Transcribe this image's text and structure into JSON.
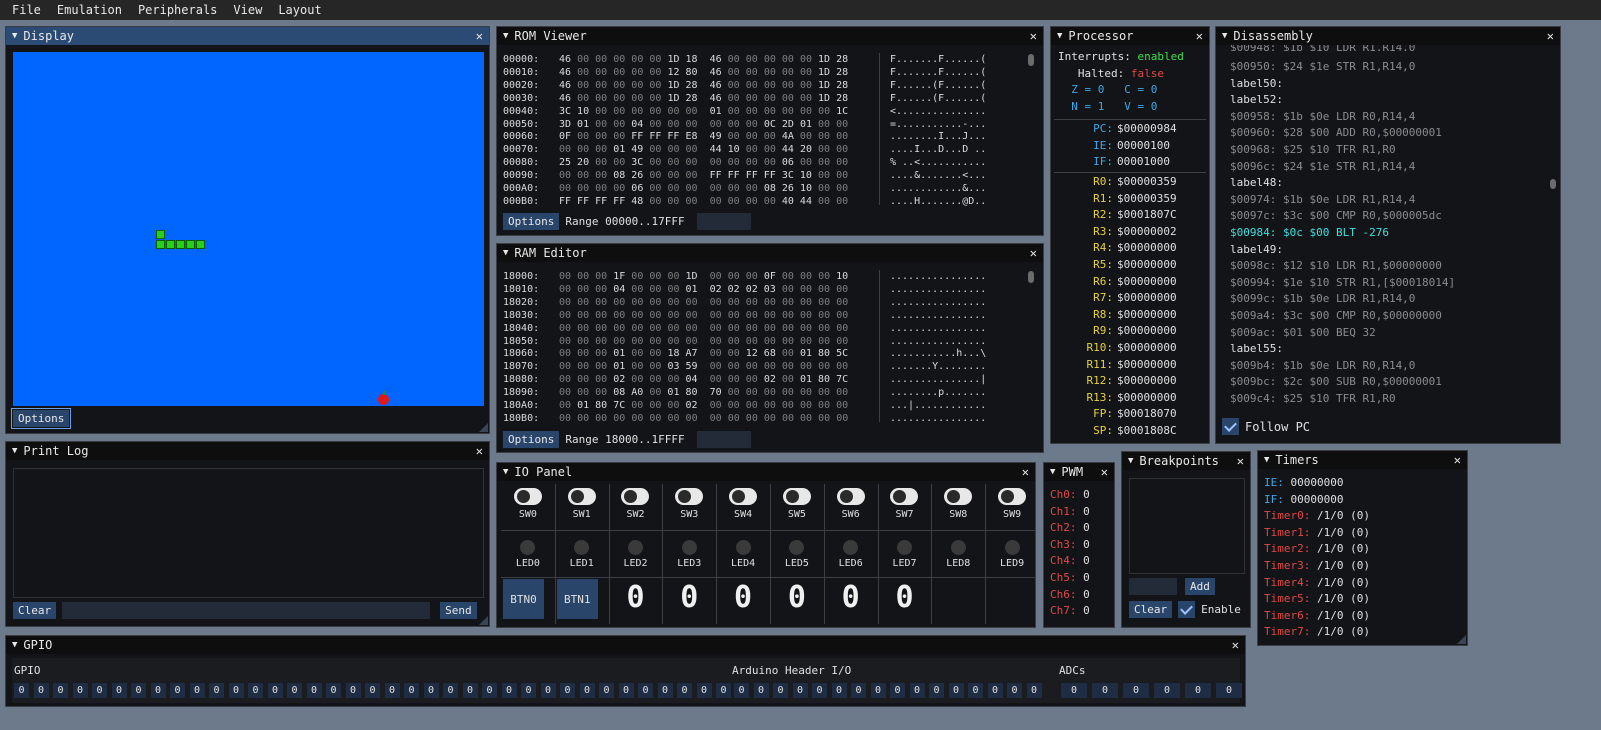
{
  "menu": [
    "File",
    "Emulation",
    "Peripherals",
    "View",
    "Layout"
  ],
  "display": {
    "title": "Display",
    "options": "Options"
  },
  "rom": {
    "title": "ROM Viewer",
    "rows": [
      [
        "00000:",
        "46 00 00 00 00 00 1D 18  46 00 00 00 00 00 1D 28",
        "F.......F......("
      ],
      [
        "00010:",
        "46 00 00 00 00 00 12 80  46 00 00 00 00 00 1D 28",
        "F.......F......("
      ],
      [
        "00020:",
        "46 00 00 00 00 00 1D 28  46 00 00 00 00 00 1D 28",
        "F......(F......("
      ],
      [
        "00030:",
        "46 00 00 00 00 00 1D 28  46 00 00 00 00 00 1D 28",
        "F......(F......("
      ],
      [
        "00040:",
        "3C 10 00 00 00 00 00 00  01 00 00 00 00 00 00 1C",
        "<..............."
      ],
      [
        "00050:",
        "3D 01 00 00 04 00 00 00  00 00 00 0C 2D 01 00 00",
        "=...........-..."
      ],
      [
        "00060:",
        "0F 00 00 00 FF FF FF E8  49 00 00 00 4A 00 00 00",
        "........I...J..."
      ],
      [
        "00070:",
        "00 00 00 01 49 00 00 00  44 10 00 00 44 20 00 00",
        "....I...D...D .."
      ],
      [
        "00080:",
        "25 20 00 00 3C 00 00 00  00 00 00 00 06 00 00 00",
        "% ..<..........."
      ],
      [
        "00090:",
        "00 00 00 08 26 00 00 00  FF FF FF FF 3C 10 00 00",
        "....&.......<..."
      ],
      [
        "000A0:",
        "00 00 00 00 06 00 00 00  00 00 00 08 26 10 00 00",
        "............&..."
      ],
      [
        "000B0:",
        "FF FF FF FF 48 00 00 00  00 00 00 00 40 44 00 00",
        "....H.......@D.."
      ]
    ],
    "options": "Options",
    "range": "Range 00000..17FFF"
  },
  "ram": {
    "title": "RAM Editor",
    "rows": [
      [
        "18000:",
        "00 00 00 1F 00 00 00 1D  00 00 00 0F 00 00 00 10",
        "................"
      ],
      [
        "18010:",
        "00 00 00 04 00 00 00 01  02 02 02 03 00 00 00 00",
        "................"
      ],
      [
        "18020:",
        "00 00 00 00 00 00 00 00  00 00 00 00 00 00 00 00",
        "................"
      ],
      [
        "18030:",
        "00 00 00 00 00 00 00 00  00 00 00 00 00 00 00 00",
        "................"
      ],
      [
        "18040:",
        "00 00 00 00 00 00 00 00  00 00 00 00 00 00 00 00",
        "................"
      ],
      [
        "18050:",
        "00 00 00 00 00 00 00 00  00 00 00 00 00 00 00 00",
        "................"
      ],
      [
        "18060:",
        "00 00 00 01 00 00 18 A7  00 00 12 68 00 01 80 5C",
        "...........h...\\"
      ],
      [
        "18070:",
        "00 00 00 01 00 00 03 59  00 00 00 00 00 00 00 00",
        ".......Y........"
      ],
      [
        "18080:",
        "00 00 00 02 00 00 00 04  00 00 00 02 00 01 80 7C",
        "...............|"
      ],
      [
        "18090:",
        "00 00 00 08 A0 00 01 80  70 00 00 00 00 00 00 00",
        "........p......."
      ],
      [
        "180A0:",
        "00 01 80 7C 00 00 00 02  00 00 00 00 00 00 00 00",
        "...|............"
      ],
      [
        "180B0:",
        "00 00 00 00 00 00 00 00  00 00 00 00 00 00 00 00",
        "................"
      ]
    ],
    "options": "Options",
    "range": "Range 18000..1FFFF"
  },
  "processor": {
    "title": "Processor",
    "interrupts_label": "Interrupts:",
    "interrupts_val": "enabled",
    "halted_label": "Halted:",
    "halted_val": "false",
    "z": "Z = 0",
    "c": "C = 0",
    "n": "N = 1",
    "v": "V = 0",
    "specials": [
      [
        "PC:",
        "$00000984"
      ],
      [
        "IE:",
        "00000100"
      ],
      [
        "IF:",
        "00001000"
      ]
    ],
    "regs": [
      [
        "R0:",
        "$00000359"
      ],
      [
        "R1:",
        "$00000359"
      ],
      [
        "R2:",
        "$0001807C"
      ],
      [
        "R3:",
        "$00000002"
      ],
      [
        "R4:",
        "$00000000"
      ],
      [
        "R5:",
        "$00000000"
      ],
      [
        "R6:",
        "$00000000"
      ],
      [
        "R7:",
        "$00000000"
      ],
      [
        "R8:",
        "$00000000"
      ],
      [
        "R9:",
        "$00000000"
      ],
      [
        "R10:",
        "$00000000"
      ],
      [
        "R11:",
        "$00000000"
      ],
      [
        "R12:",
        "$00000000"
      ],
      [
        "R13:",
        "$00000000"
      ],
      [
        "FP:",
        "$00018070"
      ],
      [
        "SP:",
        "$0001808C"
      ]
    ]
  },
  "disasm": {
    "title": "Disassembly",
    "lines": [
      [
        "g",
        "$00950: $24 $1e STR R1,R14,0"
      ],
      [
        "w",
        "label50:"
      ],
      [
        "w",
        "label52:"
      ],
      [
        "g",
        "$00958: $1b $0e LDR R0,R14,4"
      ],
      [
        "g",
        "$00960: $28 $00 ADD R0,$00000001"
      ],
      [
        "g",
        "$00968: $25 $10 TFR R1,R0"
      ],
      [
        "g",
        "$0096c: $24 $1e STR R1,R14,4"
      ],
      [
        "w",
        "label48:"
      ],
      [
        "g",
        "$00974: $1b $0e LDR R1,R14,4"
      ],
      [
        "g",
        "$0097c: $3c $00 CMP R0,$000005dc"
      ],
      [
        "c",
        "$00984: $0c $00 BLT -276"
      ],
      [
        "w",
        "label49:"
      ],
      [
        "g",
        "$0098c: $12 $10 LDR R1,$00000000"
      ],
      [
        "g",
        "$00994: $1e $10 STR R1,[$00018014]"
      ],
      [
        "g",
        "$0099c: $1b $0e LDR R1,R14,0"
      ],
      [
        "g",
        "$009a4: $3c $00 CMP R0,$00000000"
      ],
      [
        "g",
        "$009ac: $01 $00 BEQ 32"
      ],
      [
        "w",
        "label55:"
      ],
      [
        "g",
        "$009b4: $1b $0e LDR R0,R14,0"
      ],
      [
        "g",
        "$009bc: $2c $00 SUB R0,$00000001"
      ],
      [
        "g",
        "$009c4: $25 $10 TFR R1,R0"
      ]
    ],
    "follow": "Follow PC"
  },
  "printlog": {
    "title": "Print Log",
    "clear": "Clear",
    "send": "Send"
  },
  "io": {
    "title": "IO Panel",
    "switches": [
      "SW0",
      "SW1",
      "SW2",
      "SW3",
      "SW4",
      "SW5",
      "SW6",
      "SW7",
      "SW8",
      "SW9"
    ],
    "leds": [
      "LED0",
      "LED1",
      "LED2",
      "LED3",
      "LED4",
      "LED5",
      "LED6",
      "LED7",
      "LED8",
      "LED9"
    ],
    "buttons": [
      "BTN0",
      "BTN1"
    ],
    "segments": [
      "0",
      "0",
      "0",
      "0",
      "0",
      "0"
    ]
  },
  "pwm": {
    "title": "PWM",
    "channels": [
      [
        "Ch0:",
        "0"
      ],
      [
        "Ch1:",
        "0"
      ],
      [
        "Ch2:",
        "0"
      ],
      [
        "Ch3:",
        "0"
      ],
      [
        "Ch4:",
        "0"
      ],
      [
        "Ch5:",
        "0"
      ],
      [
        "Ch6:",
        "0"
      ],
      [
        "Ch7:",
        "0"
      ]
    ]
  },
  "breakpoints": {
    "title": "Breakpoints",
    "add": "Add",
    "clear": "Clear",
    "enable": "Enable"
  },
  "timers": {
    "title": "Timers",
    "ie": [
      "IE:",
      "00000000"
    ],
    "if": [
      "IF:",
      "00000000"
    ],
    "rows": [
      [
        "Timer0:",
        "/1/0 (0)"
      ],
      [
        "Timer1:",
        "/1/0 (0)"
      ],
      [
        "Timer2:",
        "/1/0 (0)"
      ],
      [
        "Timer3:",
        "/1/0 (0)"
      ],
      [
        "Timer4:",
        "/1/0 (0)"
      ],
      [
        "Timer5:",
        "/1/0 (0)"
      ],
      [
        "Timer6:",
        "/1/0 (0)"
      ],
      [
        "Timer7:",
        "/1/0 (0)"
      ]
    ]
  },
  "gpio": {
    "title": "GPIO",
    "gpio_label": "GPIO",
    "arduino_label": "Arduino Header I/O",
    "adc_label": "ADCs",
    "gpio_vals": [
      "0",
      "0",
      "0",
      "0",
      "0",
      "0",
      "0",
      "0",
      "0",
      "0",
      "0",
      "0",
      "0",
      "0",
      "0",
      "0",
      "0",
      "0",
      "0",
      "0",
      "0",
      "0",
      "0",
      "0",
      "0",
      "0",
      "0",
      "0",
      "0",
      "0",
      "0",
      "0",
      "0",
      "0",
      "0",
      "0",
      "0"
    ],
    "arduino_vals": [
      "0",
      "0",
      "0",
      "0",
      "0",
      "0",
      "0",
      "0",
      "0",
      "0",
      "0",
      "0",
      "0",
      "0",
      "0",
      "0"
    ],
    "adc_vals": [
      "0",
      "0",
      "0",
      "0",
      "0",
      "0"
    ]
  }
}
